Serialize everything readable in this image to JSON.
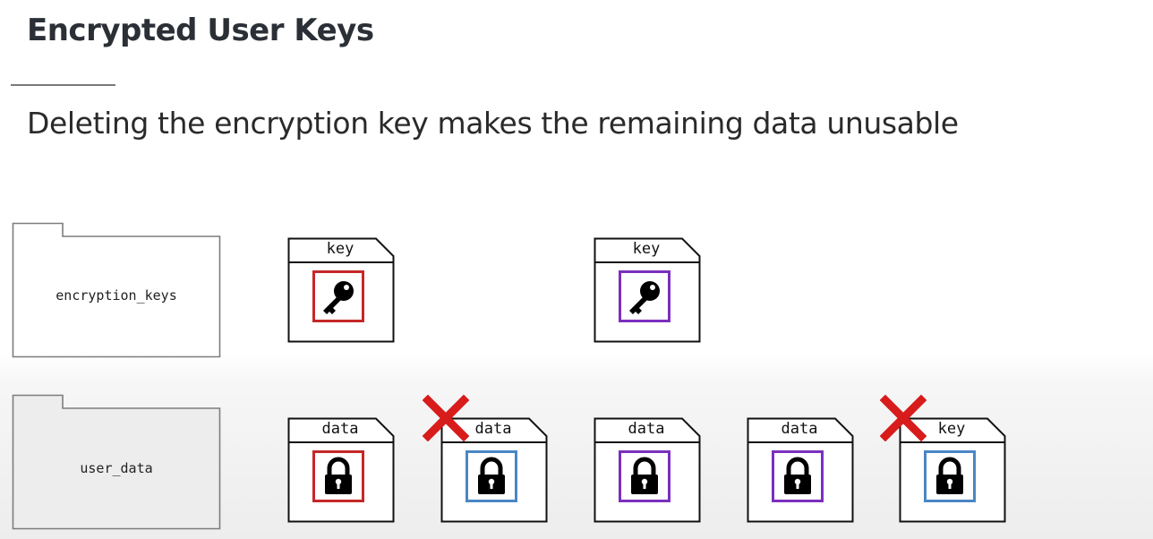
{
  "slide": {
    "title": "Encrypted User Keys",
    "subtitle": "Deleting the encryption key makes the remaining data unusable"
  },
  "tables": {
    "keys_table": {
      "label": "encryption_keys"
    },
    "data_table": {
      "label": "user_data"
    }
  },
  "colors": {
    "red": "#c62828",
    "purple": "#7b2fbe",
    "blue": "#4a86c5",
    "delete_mark": "#d81b1b"
  },
  "key_cards": [
    {
      "label": "key",
      "icon": "key-icon",
      "border_color": "red"
    },
    {
      "label": "key",
      "icon": "key-icon",
      "border_color": "purple"
    }
  ],
  "data_cards": [
    {
      "label": "data",
      "icon": "lock-icon",
      "border_color": "red",
      "deleted": false
    },
    {
      "label": "data",
      "icon": "lock-icon",
      "border_color": "blue",
      "deleted": true
    },
    {
      "label": "data",
      "icon": "lock-icon",
      "border_color": "purple",
      "deleted": false
    },
    {
      "label": "data",
      "icon": "lock-icon",
      "border_color": "purple",
      "deleted": false
    },
    {
      "label": "key",
      "icon": "lock-icon",
      "border_color": "blue",
      "deleted": true
    }
  ]
}
